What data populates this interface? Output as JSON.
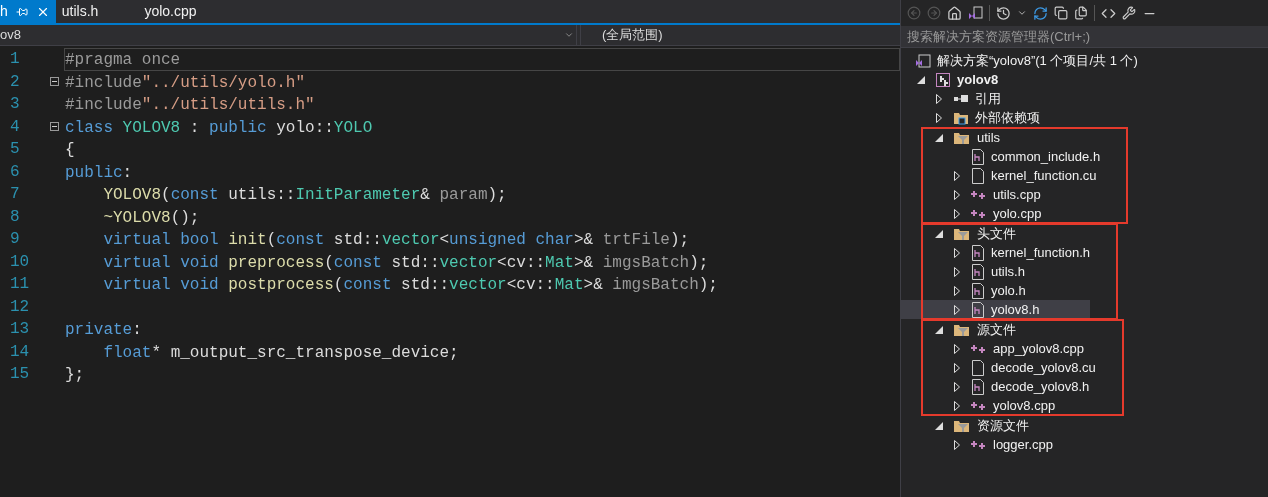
{
  "tabs": [
    {
      "label": "h",
      "selected": true,
      "pinned": true
    },
    {
      "label": "utils.h",
      "selected": false,
      "pinned": false
    },
    {
      "label": "yolo.cpp",
      "selected": false,
      "pinned": false
    }
  ],
  "nav_bar": {
    "project": "ov8",
    "scope": "(全局范围)"
  },
  "code": [
    {
      "number": "1",
      "current": true,
      "fold_marker": false,
      "tokens": [
        {
          "kind": "preproc",
          "text": "#pragma once"
        }
      ]
    },
    {
      "number": "2",
      "current": false,
      "fold_marker": true,
      "tokens": [
        {
          "kind": "preproc",
          "text": "#include"
        },
        {
          "kind": "string",
          "text": "\"../utils/yolo.h\""
        }
      ]
    },
    {
      "number": "3",
      "current": false,
      "fold_marker": false,
      "tokens": [
        {
          "kind": "preproc",
          "text": "#include"
        },
        {
          "kind": "string",
          "text": "\"../utils/utils.h\""
        }
      ]
    },
    {
      "number": "4",
      "current": false,
      "fold_marker": true,
      "tokens": [
        {
          "kind": "keyword",
          "text": "class "
        },
        {
          "kind": "type",
          "text": "YOLOV8"
        },
        {
          "kind": "plain",
          "text": " : "
        },
        {
          "kind": "keyword",
          "text": "public"
        },
        {
          "kind": "plain",
          "text": " yolo::"
        },
        {
          "kind": "type",
          "text": "YOLO"
        }
      ]
    },
    {
      "number": "5",
      "current": false,
      "fold_marker": false,
      "tokens": [
        {
          "kind": "plain",
          "text": "{"
        }
      ]
    },
    {
      "number": "6",
      "current": false,
      "fold_marker": false,
      "tokens": [
        {
          "kind": "keyword",
          "text": "public"
        },
        {
          "kind": "plain",
          "text": ":"
        }
      ]
    },
    {
      "number": "7",
      "current": false,
      "fold_marker": false,
      "tokens": [
        {
          "kind": "function",
          "text": "    YOLOV8"
        },
        {
          "kind": "plain",
          "text": "("
        },
        {
          "kind": "keyword",
          "text": "const"
        },
        {
          "kind": "plain",
          "text": " utils::"
        },
        {
          "kind": "type",
          "text": "InitParameter"
        },
        {
          "kind": "plain",
          "text": "& "
        },
        {
          "kind": "param",
          "text": "param"
        },
        {
          "kind": "plain",
          "text": ");"
        }
      ]
    },
    {
      "number": "8",
      "current": false,
      "fold_marker": false,
      "tokens": [
        {
          "kind": "function",
          "text": "    ~YOLOV8"
        },
        {
          "kind": "plain",
          "text": "();"
        }
      ]
    },
    {
      "number": "9",
      "current": false,
      "fold_marker": false,
      "tokens": [
        {
          "kind": "keyword",
          "text": "    virtual bool "
        },
        {
          "kind": "function",
          "text": "init"
        },
        {
          "kind": "plain",
          "text": "("
        },
        {
          "kind": "keyword",
          "text": "const"
        },
        {
          "kind": "plain",
          "text": " std::"
        },
        {
          "kind": "type",
          "text": "vector"
        },
        {
          "kind": "plain",
          "text": "<"
        },
        {
          "kind": "keyword",
          "text": "unsigned char"
        },
        {
          "kind": "plain",
          "text": ">& "
        },
        {
          "kind": "param",
          "text": "trtFile"
        },
        {
          "kind": "plain",
          "text": ");"
        }
      ]
    },
    {
      "number": "10",
      "current": false,
      "fold_marker": false,
      "tokens": [
        {
          "kind": "keyword",
          "text": "    virtual void "
        },
        {
          "kind": "function",
          "text": "preprocess"
        },
        {
          "kind": "plain",
          "text": "("
        },
        {
          "kind": "keyword",
          "text": "const"
        },
        {
          "kind": "plain",
          "text": " std::"
        },
        {
          "kind": "type",
          "text": "vector"
        },
        {
          "kind": "plain",
          "text": "<cv::"
        },
        {
          "kind": "type",
          "text": "Mat"
        },
        {
          "kind": "plain",
          "text": ">& "
        },
        {
          "kind": "param",
          "text": "imgsBatch"
        },
        {
          "kind": "plain",
          "text": ");"
        }
      ]
    },
    {
      "number": "11",
      "current": false,
      "fold_marker": false,
      "tokens": [
        {
          "kind": "keyword",
          "text": "    virtual void "
        },
        {
          "kind": "function",
          "text": "postprocess"
        },
        {
          "kind": "plain",
          "text": "("
        },
        {
          "kind": "keyword",
          "text": "const"
        },
        {
          "kind": "plain",
          "text": " std::"
        },
        {
          "kind": "type",
          "text": "vector"
        },
        {
          "kind": "plain",
          "text": "<cv::"
        },
        {
          "kind": "type",
          "text": "Mat"
        },
        {
          "kind": "plain",
          "text": ">& "
        },
        {
          "kind": "param",
          "text": "imgsBatch"
        },
        {
          "kind": "plain",
          "text": ");"
        }
      ]
    },
    {
      "number": "12",
      "current": false,
      "fold_marker": false
    },
    {
      "number": "13",
      "current": false,
      "fold_marker": false,
      "tokens": [
        {
          "kind": "keyword",
          "text": "private"
        },
        {
          "kind": "plain",
          "text": ":"
        }
      ]
    },
    {
      "number": "14",
      "current": false,
      "fold_marker": false,
      "tokens": [
        {
          "kind": "keyword",
          "text": "    float"
        },
        {
          "kind": "plain",
          "text": "* m_output_src_transpose_device;"
        }
      ]
    },
    {
      "number": "15",
      "current": false,
      "fold_marker": false,
      "tokens": [
        {
          "kind": "plain",
          "text": "};"
        }
      ]
    }
  ],
  "solution_explorer": {
    "search": {
      "placeholder": "搜索解决方案资源管理器(Ctrl+;)"
    },
    "tree": [
      {
        "label": "解决方案“yolov8”(1 个项目/共 1 个)",
        "kind": "solution",
        "selected": false,
        "outlined": false,
        "children": [
          {
            "label": "yolov8",
            "kind": "project",
            "expanded": true,
            "selected": false,
            "outlined": false,
            "children": [
              {
                "label": "引用",
                "kind": "references",
                "expanded": false,
                "selected": false,
                "outlined": false
              },
              {
                "label": "外部依赖项",
                "kind": "external",
                "expanded": false,
                "selected": false,
                "outlined": false
              },
              {
                "label": "utils",
                "kind": "filter",
                "expanded": true,
                "selected": false,
                "outlined": true,
                "children": [
                  {
                    "label": "common_include.h",
                    "kind": "header",
                    "selected": false,
                    "outlined": false
                  },
                  {
                    "label": "kernel_function.cu",
                    "kind": "file",
                    "expanded": false,
                    "selected": false,
                    "outlined": false
                  },
                  {
                    "label": "utils.cpp",
                    "kind": "cpp",
                    "expanded": false,
                    "selected": false,
                    "outlined": false
                  },
                  {
                    "label": "yolo.cpp",
                    "kind": "cpp",
                    "expanded": false,
                    "selected": false,
                    "outlined": false
                  }
                ]
              },
              {
                "label": "头文件",
                "kind": "filter",
                "expanded": true,
                "selected": false,
                "outlined": true,
                "children": [
                  {
                    "label": "kernel_function.h",
                    "kind": "header",
                    "expanded": false,
                    "selected": false,
                    "outlined": false
                  },
                  {
                    "label": "utils.h",
                    "kind": "header",
                    "expanded": false,
                    "selected": false,
                    "outlined": false
                  },
                  {
                    "label": "yolo.h",
                    "kind": "header",
                    "expanded": false,
                    "selected": false,
                    "outlined": false
                  },
                  {
                    "label": "yolov8.h",
                    "kind": "header",
                    "expanded": false,
                    "selected": true,
                    "outlined": false
                  }
                ]
              },
              {
                "label": "源文件",
                "kind": "filter",
                "expanded": true,
                "selected": false,
                "outlined": true,
                "children": [
                  {
                    "label": "app_yolov8.cpp",
                    "kind": "cpp",
                    "expanded": false,
                    "selected": false,
                    "outlined": false
                  },
                  {
                    "label": "decode_yolov8.cu",
                    "kind": "file",
                    "expanded": false,
                    "selected": false,
                    "outlined": false
                  },
                  {
                    "label": "decode_yolov8.h",
                    "kind": "header",
                    "expanded": false,
                    "selected": false,
                    "outlined": false
                  },
                  {
                    "label": "yolov8.cpp",
                    "kind": "cpp",
                    "expanded": false,
                    "selected": false,
                    "outlined": false
                  }
                ]
              },
              {
                "label": "资源文件",
                "kind": "filter",
                "expanded": true,
                "selected": false,
                "outlined": false,
                "children": [
                  {
                    "label": "logger.cpp",
                    "kind": "cpp",
                    "expanded": false,
                    "selected": false,
                    "outlined": false
                  }
                ]
              }
            ]
          }
        ]
      }
    ]
  }
}
